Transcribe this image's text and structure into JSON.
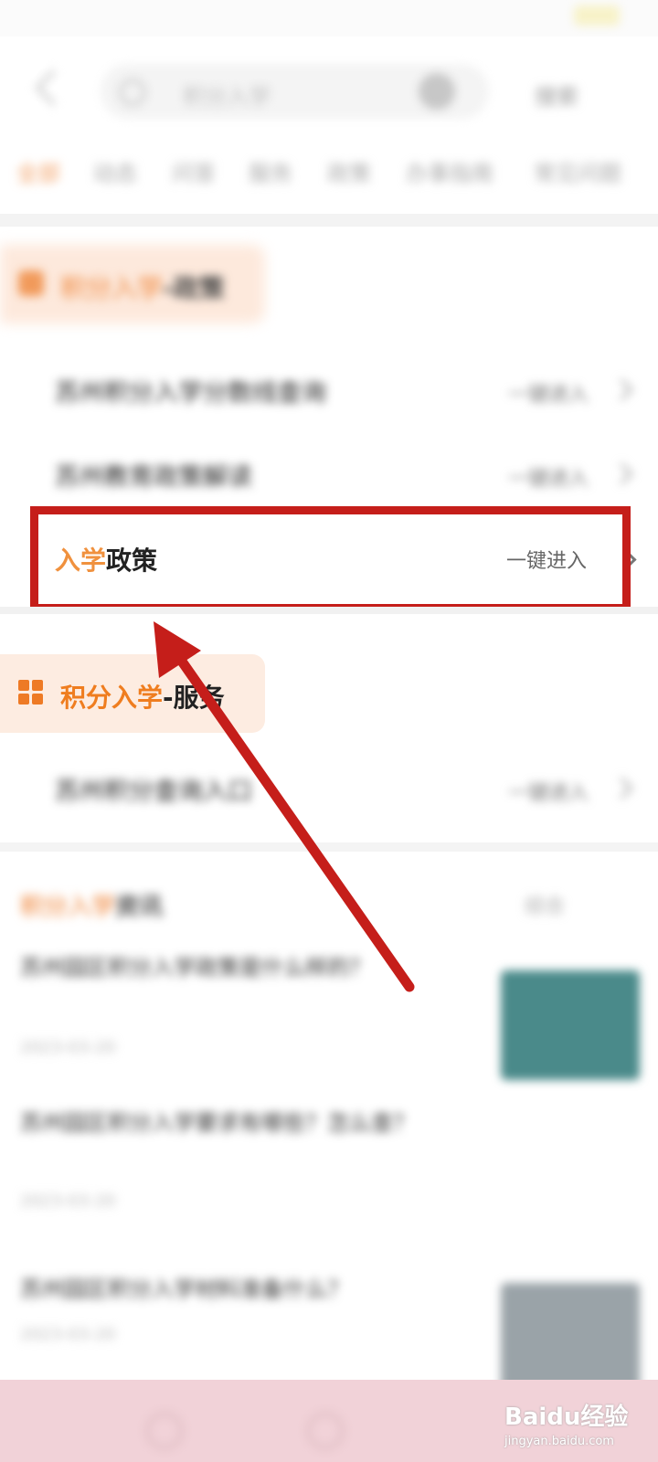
{
  "header": {
    "search_text": "积分入学",
    "search_button": "搜索"
  },
  "tabs": [
    {
      "label": "全部"
    },
    {
      "label": "动态"
    },
    {
      "label": "问答"
    },
    {
      "label": "服务"
    },
    {
      "label": "政策"
    },
    {
      "label": "办事指南"
    },
    {
      "label": "常见问题"
    }
  ],
  "section_policy": {
    "title_orange": "积分入学",
    "title_rest": "-政策"
  },
  "policy_rows": [
    {
      "title": "苏州积分入学分数线查询",
      "enter": "一键进入"
    },
    {
      "title": "苏州教育政策解读",
      "enter": "一键进入"
    }
  ],
  "highlight_row": {
    "title_orange": "入学",
    "title_rest": "政策",
    "enter": "一键进入"
  },
  "section_service": {
    "title_orange": "积分入学",
    "title_rest": "-服务"
  },
  "service_rows": [
    {
      "title": "苏州积分查询入口",
      "enter": "一键进入"
    }
  ],
  "news": {
    "title_orange": "积分入学",
    "title_rest": "资讯",
    "sort": "综合",
    "items": [
      {
        "title": "苏州园区积分入学政策是什么样的？",
        "meta": "2023-03-20"
      },
      {
        "title": "苏州园区积分入学要求有哪些？怎么查？",
        "meta": "2023-03-20"
      },
      {
        "title": "苏州园区积分入学材料准备什么？",
        "meta": "2023-03-20"
      }
    ]
  },
  "watermark": {
    "brand": "Baidu经验",
    "url": "jingyan.baidu.com"
  },
  "colors": {
    "accent_orange": "#ef7d1f",
    "highlight_red": "#c51e1a"
  }
}
